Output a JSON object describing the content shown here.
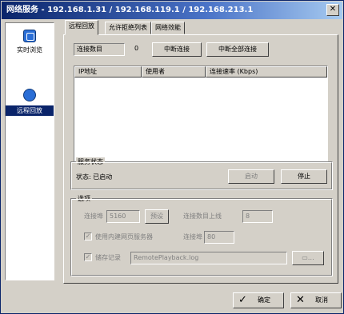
{
  "window": {
    "title": "网络服务 - 192.168.1.31 / 192.168.119.1 / 192.168.213.1",
    "close_symbol": "✕"
  },
  "sidebar": {
    "items": [
      {
        "label": "实时浏览",
        "icon": "monitor-icon",
        "selected": false
      },
      {
        "label": "远程回放",
        "icon": "remote-playback-icon",
        "selected": true
      }
    ]
  },
  "tabs": [
    {
      "label": "远程回放",
      "active": true
    },
    {
      "label": "允许拒绝列表",
      "active": false
    },
    {
      "label": "网络效能",
      "active": false
    }
  ],
  "connections": {
    "count_label": "连接数目",
    "count_value": "0",
    "disconnect_label": "中断连接",
    "disconnect_all_label": "中断全部连接",
    "columns": [
      "IP地址",
      "使用者",
      "连接速率 (Kbps)"
    ],
    "rows": []
  },
  "service": {
    "group_title": "服务状态",
    "status_text": "状态: 已启动",
    "start_label": "启动",
    "stop_label": "停止"
  },
  "options": {
    "group_title": "选项",
    "port_label": "连接埠",
    "port_value": "5160",
    "default_label": "预设",
    "max_conn_label": "连接数目上线",
    "max_conn_value": "8",
    "web_server_label": "使用内建网页服务器",
    "web_server_checked": true,
    "web_port_label": "连接埠",
    "web_port_value": "80",
    "log_label": "储存记录",
    "log_checked": true,
    "log_file": "RemotePlayback.log"
  },
  "footer": {
    "ok_label": "确定",
    "cancel_label": "取消"
  }
}
